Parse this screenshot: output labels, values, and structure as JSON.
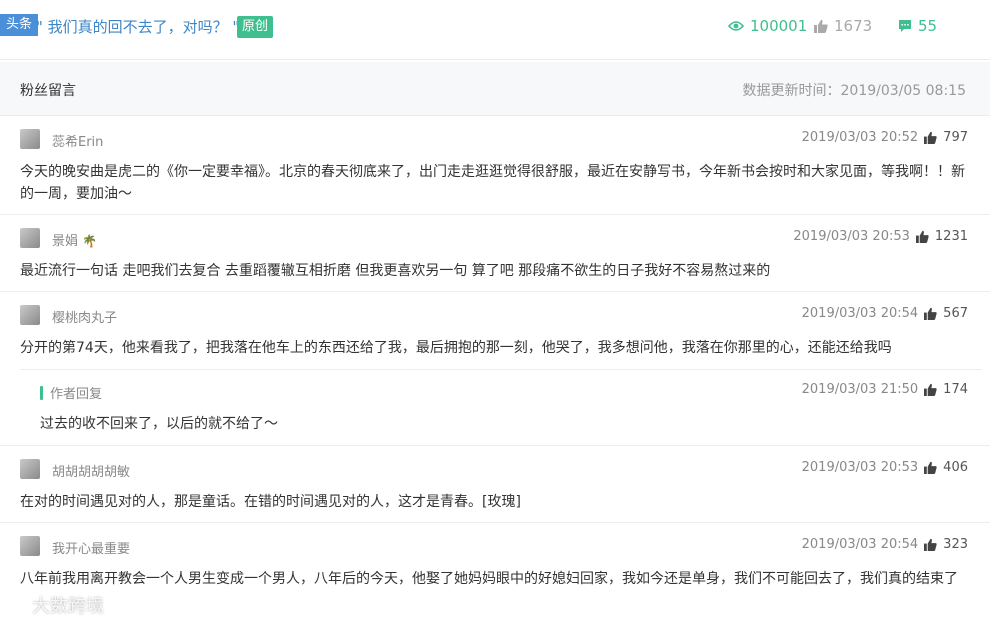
{
  "header": {
    "tag": "头条",
    "title": "\" 我们真的回不去了，对吗？ \"",
    "original_tag": "原创",
    "views": "100001",
    "likes": "1673",
    "comments": "55"
  },
  "section": {
    "title": "粉丝留言",
    "update_time": "数据更新时间：2019/03/05 08:15"
  },
  "comments": [
    {
      "nick": "蕊希Erin",
      "time": "2019/03/03 20:52",
      "likes": "797",
      "text": "今天的晚安曲是虎二的《你一定要幸福》。北京的春天彻底来了，出门走走逛逛觉得很舒服，最近在安静写书，今年新书会按时和大家见面，等我啊！！新的一周，要加油～"
    },
    {
      "nick": "景娟",
      "nick_emoji": "🌴",
      "time": "2019/03/03 20:53",
      "likes": "1231",
      "text": "最近流行一句话 走吧我们去复合 去重蹈覆辙互相折磨 但我更喜欢另一句 算了吧 那段痛不欲生的日子我好不容易熬过来的"
    },
    {
      "nick": "樱桃肉丸子",
      "time": "2019/03/03 20:54",
      "likes": "567",
      "text": "分开的第74天，他来看我了，把我落在他车上的东西还给了我，最后拥抱的那一刻，他哭了，我多想问他，我落在你那里的心，还能还给我吗",
      "reply": {
        "label": "作者回复",
        "time": "2019/03/03 21:50",
        "likes": "174",
        "text": "过去的收不回来了，以后的就不给了～"
      }
    },
    {
      "nick": "胡胡胡胡胡敏",
      "time": "2019/03/03 20:53",
      "likes": "406",
      "text": "在对的时间遇见对的人，那是童话。在错的时间遇见对的人，这才是青春。[玫瑰]"
    },
    {
      "nick": "我开心最重要",
      "time": "2019/03/03 20:54",
      "likes": "323",
      "text": "八年前我用离开教会一个人男生变成一个男人，八年后的今天，他娶了她妈妈眼中的好媳妇回家，我如今还是单身，我们不可能回去了，我们真的结束了"
    }
  ],
  "watermark": "大数跨境",
  "colors": {
    "accent": "#3fbf8f",
    "title_blue": "#3d86c6",
    "tag_blue": "#4a90d9"
  },
  "icons": {
    "views": "eye-icon",
    "likes": "thumb-up-icon",
    "comments": "comment-icon"
  }
}
